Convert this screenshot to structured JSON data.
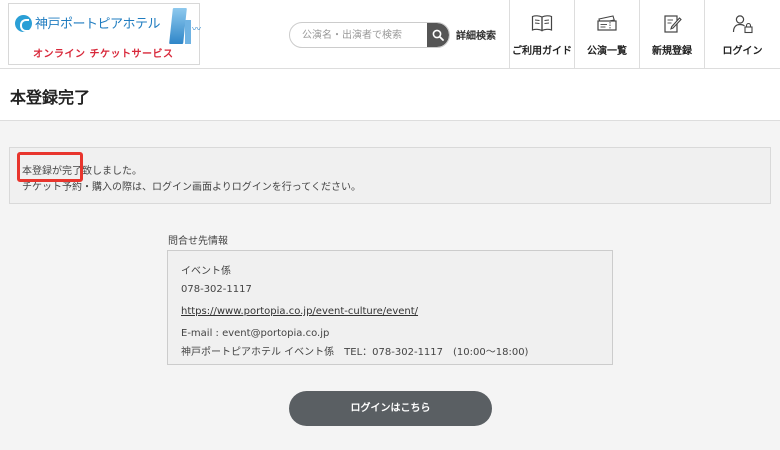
{
  "logo": {
    "name": "神戸ポートピアホテル",
    "sub": "オンライン チケットサービス"
  },
  "search": {
    "placeholder": "公演名・出演者で検索",
    "value": "",
    "advanced_label": "詳細検索"
  },
  "nav": [
    {
      "label": "ご利用ガイド",
      "icon": "book-icon"
    },
    {
      "label": "公演一覧",
      "icon": "ticket-icon"
    },
    {
      "label": "新規登録",
      "icon": "edit-icon"
    },
    {
      "label": "ログイン",
      "icon": "user-lock-icon"
    }
  ],
  "page_title": "本登録完了",
  "notice": {
    "line1": "本登録が完了致しました。",
    "line2": "チケット予約・購入の際は、ログイン画面よりログインを行ってください。"
  },
  "contact": {
    "heading": "問合せ先情報",
    "department": "イベント係",
    "phone": "078-302-1117",
    "url": "https://www.portopia.co.jp/event-culture/event/",
    "email": "E-mail : event@portopia.co.jp",
    "footer": "神戸ポートピアホテル イベント係　TEL：078-302-1117　(10:00～18:00)"
  },
  "login_button": "ログインはこちら",
  "colors": {
    "highlight": "#e8352d",
    "button": "#5a5f63",
    "logo_blue": "#1f7cc0",
    "logo_red": "#d8283a"
  }
}
